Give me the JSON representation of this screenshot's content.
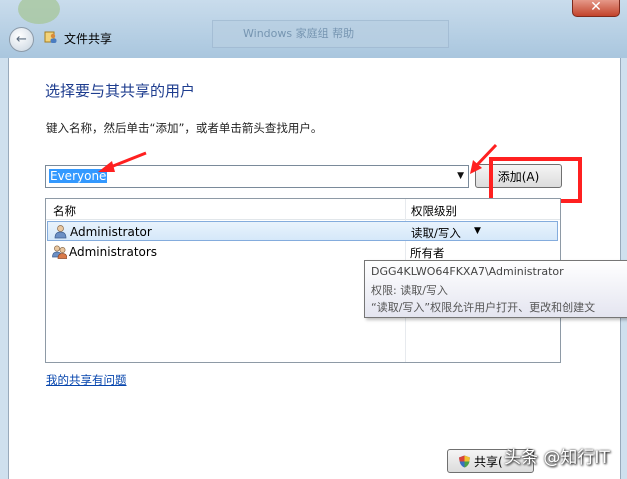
{
  "window": {
    "title": "文件共享",
    "bg_window_text": "Windows 家庭组 帮助",
    "close_glyph": "✕"
  },
  "page": {
    "heading": "选择要与其共享的用户",
    "instruction": "键入名称，然后单击“添加”，或者单击箭头查找用户。"
  },
  "combo": {
    "value": "Everyone"
  },
  "add_button": {
    "label": "添加(A)"
  },
  "list": {
    "columns": [
      "名称",
      "权限级别"
    ],
    "rows": [
      {
        "name": "Administrator",
        "permission": "读取/写入",
        "icon": "user-icon",
        "selected": true
      },
      {
        "name": "Administrators",
        "permission": "所有者",
        "icon": "group-icon",
        "selected": false
      }
    ]
  },
  "tooltip": {
    "line1": "DGG4KLWO64FKXA7\\Administrator",
    "line2": "权限: 读取/写入",
    "line3": "“读取/写入”权限允许用户打开、更改和创建文"
  },
  "help_link": "我的共享有问题",
  "share_button": {
    "label": "共享("
  },
  "watermark": "头条 @知行IT",
  "colors": {
    "heading": "#1e3d8f",
    "link": "#0645ad",
    "annotation": "#ff2020",
    "selection": "#3399ff"
  }
}
